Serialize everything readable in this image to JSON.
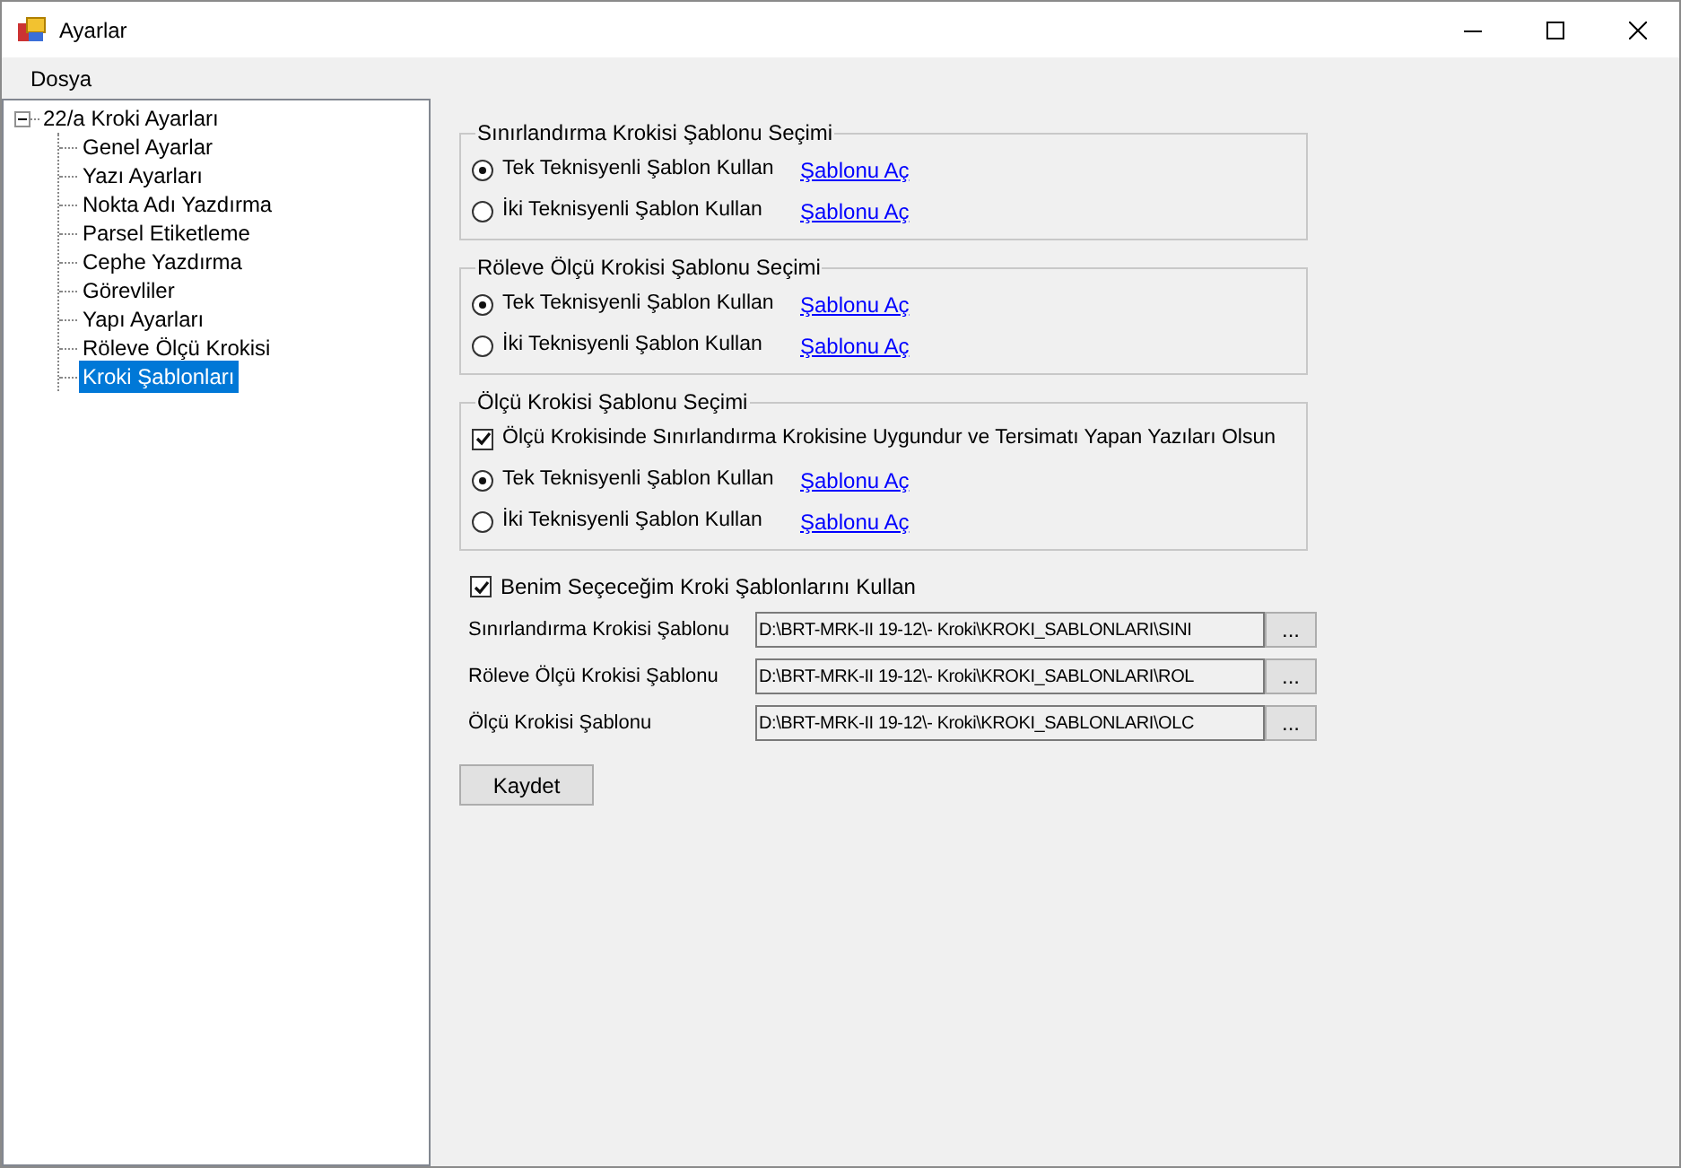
{
  "window": {
    "title": "Ayarlar"
  },
  "menu": [
    {
      "label": "Dosya"
    }
  ],
  "tree": {
    "label": "22/a Kroki Ayarları",
    "expanded": true,
    "children": [
      {
        "label": "Genel Ayarlar",
        "selected": false
      },
      {
        "label": "Yazı Ayarları",
        "selected": false
      },
      {
        "label": "Nokta Adı Yazdırma",
        "selected": false
      },
      {
        "label": "Parsel Etiketleme",
        "selected": false
      },
      {
        "label": "Cephe Yazdırma",
        "selected": false
      },
      {
        "label": "Görevliler",
        "selected": false
      },
      {
        "label": "Yapı Ayarları",
        "selected": false
      },
      {
        "label": "Röleve Ölçü Krokisi",
        "selected": false
      },
      {
        "label": "Kroki Şablonları",
        "selected": true
      }
    ]
  },
  "groups": [
    {
      "title": "Sınırlandırma Krokisi Şablonu Seçimi",
      "items": [
        {
          "kind": "radio",
          "label": "Tek Teknisyenli Şablon Kullan",
          "selected": true,
          "link": "Şablonu Aç"
        },
        {
          "kind": "radio",
          "label": "İki Teknisyenli Şablon Kullan",
          "selected": false,
          "link": "Şablonu Aç"
        }
      ]
    },
    {
      "title": "Röleve Ölçü Krokisi Şablonu Seçimi",
      "items": [
        {
          "kind": "radio",
          "label": "Tek Teknisyenli Şablon Kullan",
          "selected": true,
          "link": "Şablonu Aç"
        },
        {
          "kind": "radio",
          "label": "İki Teknisyenli Şablon Kullan",
          "selected": false,
          "link": "Şablonu Aç"
        }
      ]
    },
    {
      "title": "Ölçü Krokisi Şablonu Seçimi",
      "items": [
        {
          "kind": "checkbox",
          "label": "Ölçü Krokisinde Sınırlandırma Krokisine Uygundur ve Tersimatı Yapan Yazıları Olsun",
          "checked": true
        },
        {
          "kind": "radio",
          "label": "Tek Teknisyenli Şablon Kullan",
          "selected": true,
          "link": "Şablonu Aç"
        },
        {
          "kind": "radio",
          "label": "İki Teknisyenli Şablon Kullan",
          "selected": false,
          "link": "Şablonu Aç"
        }
      ]
    }
  ],
  "custom_templates": {
    "label": "Benim Seçeceğim Kroki Şablonlarını Kullan",
    "checked": true
  },
  "template_fields": [
    {
      "label": "Sınırlandırma Krokisi Şablonu",
      "value": "D:\\BRT-MRK-II 19-12\\- Kroki\\KROKI_SABLONLARI\\SINI",
      "button": "..."
    },
    {
      "label": "Röleve Ölçü Krokisi Şablonu",
      "value": "D:\\BRT-MRK-II 19-12\\- Kroki\\KROKI_SABLONLARI\\ROL",
      "button": "..."
    },
    {
      "label": "Ölçü Krokisi Şablonu",
      "value": "D:\\BRT-MRK-II 19-12\\- Kroki\\KROKI_SABLONLARI\\OLC",
      "button": "..."
    }
  ],
  "save_button": "Kaydet"
}
